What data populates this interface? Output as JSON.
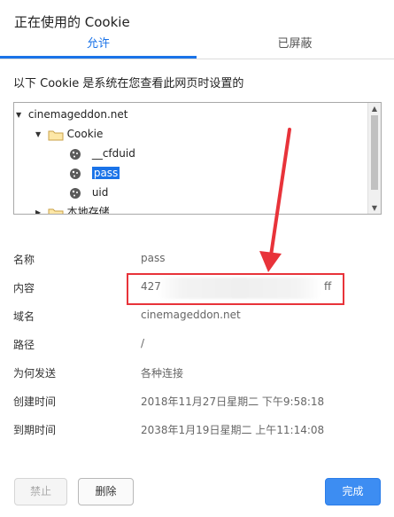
{
  "dialog": {
    "title": "正在使用的 Cookie"
  },
  "tabs": [
    {
      "label": "允许",
      "active": true
    },
    {
      "label": "已屏蔽",
      "active": false
    }
  ],
  "description": "以下 Cookie 是系统在您查看此网页时设置的",
  "tree": {
    "site": "cinemageddon.net",
    "folder": "Cookie",
    "cookies": [
      "__cfduid",
      "pass",
      "uid"
    ],
    "selected": "pass",
    "partial_next": "本地存储"
  },
  "details": [
    {
      "label": "名称",
      "value": "pass"
    },
    {
      "label": "内容",
      "value_start": "427",
      "value_end": "ff"
    },
    {
      "label": "域名",
      "value": "cinemageddon.net"
    },
    {
      "label": "路径",
      "value": "/"
    },
    {
      "label": "为何发送",
      "value": "各种连接"
    },
    {
      "label": "创建时间",
      "value": "2018年11月27日星期二 下午9:58:18"
    },
    {
      "label": "到期时间",
      "value": "2038年1月19日星期二 上午11:14:08"
    }
  ],
  "buttons": {
    "block": "禁止",
    "delete": "删除",
    "done": "完成"
  },
  "colors": {
    "accent": "#1a73e8",
    "annotation": "#e8333a",
    "done_button": "#3d8df2"
  }
}
